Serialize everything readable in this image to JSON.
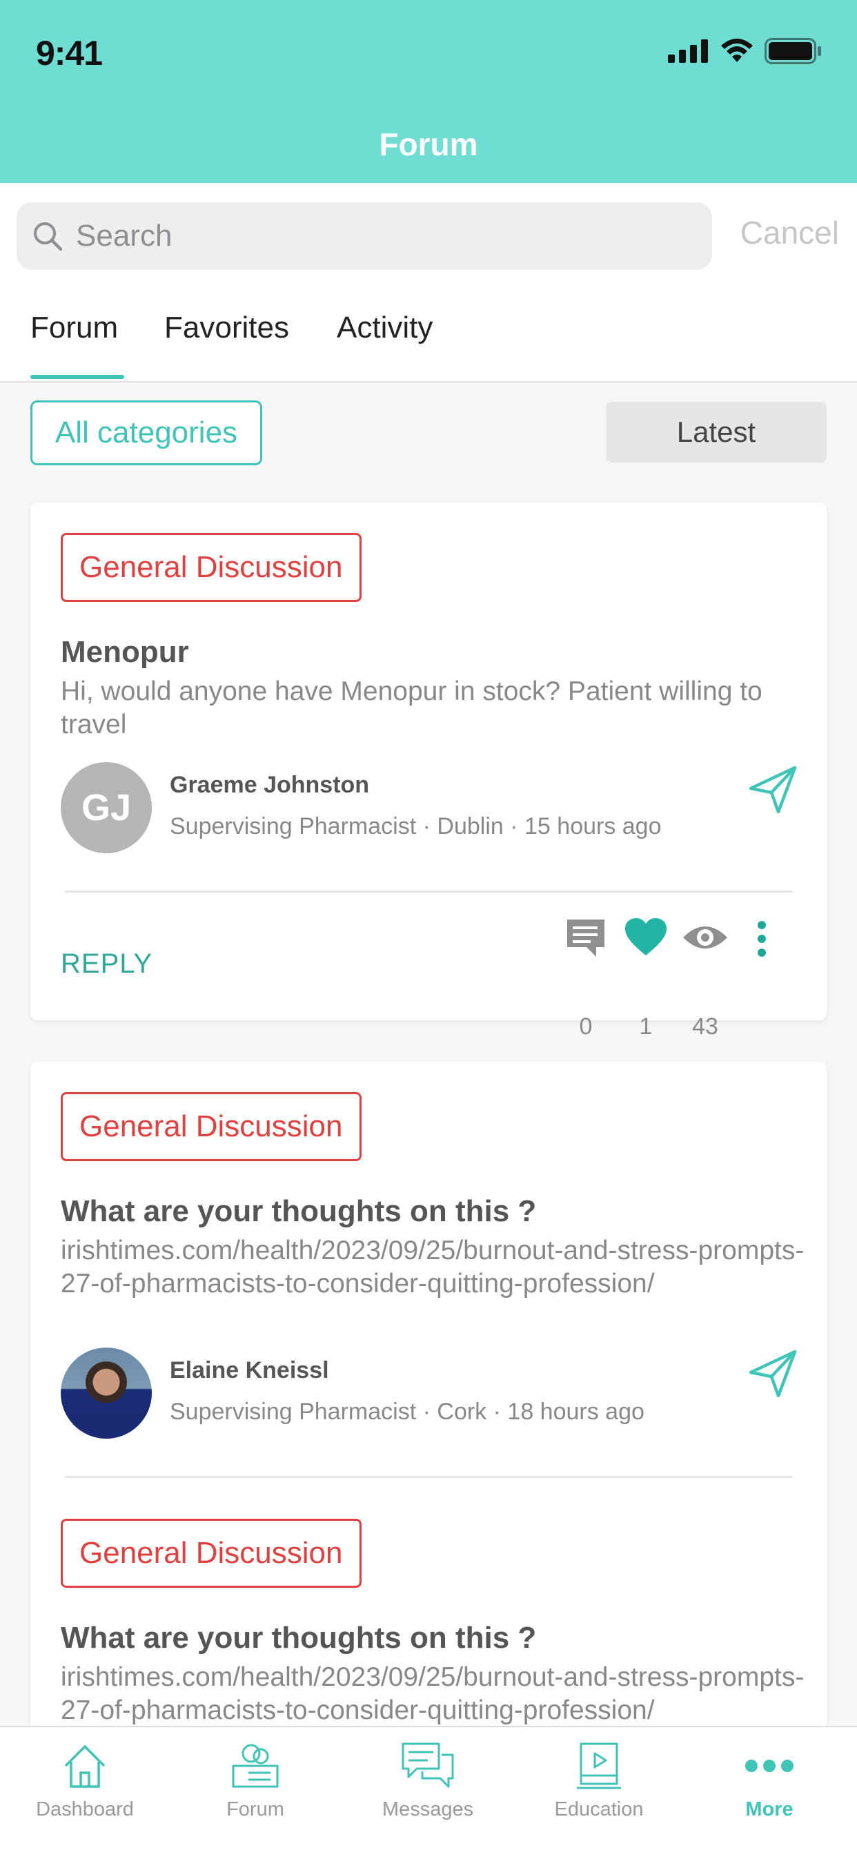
{
  "status_bar": {
    "time": "9:41"
  },
  "header": {
    "title": "Forum"
  },
  "search": {
    "placeholder": "Search",
    "cancel_label": "Cancel"
  },
  "tabs": [
    {
      "label": "Forum",
      "active": true
    },
    {
      "label": "Favorites",
      "active": false
    },
    {
      "label": "Activity",
      "active": false
    }
  ],
  "filters": {
    "category_label": "All categories",
    "sort_label": "Latest"
  },
  "posts": [
    {
      "category": "General Discussion",
      "title": "Menopur",
      "body": "Hi,  would anyone have Menopur in stock?  Patient willing to travel",
      "author": "Graeme Johnston",
      "author_initials": "GJ",
      "role": "Supervising Pharmacist",
      "location": "Dublin",
      "time_ago": "15 hours ago",
      "reply_label": "REPLY",
      "comments": "0",
      "likes": "1",
      "views": "43"
    },
    {
      "category": "General Discussion",
      "title": "What are your thoughts on this ?",
      "body": "irishtimes.com/health/2023/09/25/burnout-and-stress-prompts-27-of-pharmacists-to-consider-quitting-profession/",
      "author": "Elaine Kneissl",
      "role": "Supervising Pharmacist",
      "location": "Cork",
      "time_ago": "18 hours ago"
    },
    {
      "category": "General Discussion",
      "title": "What are your thoughts on this ?",
      "body": "irishtimes.com/health/2023/09/25/burnout-and-stress-prompts-27-of-pharmacists-to-consider-quitting-profession/"
    }
  ],
  "tab_bar": [
    {
      "label": "Dashboard",
      "icon": "house-icon"
    },
    {
      "label": "Forum",
      "icon": "forum-icon"
    },
    {
      "label": "Messages",
      "icon": "messages-icon"
    },
    {
      "label": "Education",
      "icon": "education-icon"
    },
    {
      "label": "More",
      "icon": "more-icon",
      "active": true
    }
  ],
  "colors": {
    "accent": "#3fc5b8",
    "header": "#6fddd2",
    "tag": "#e04040"
  }
}
